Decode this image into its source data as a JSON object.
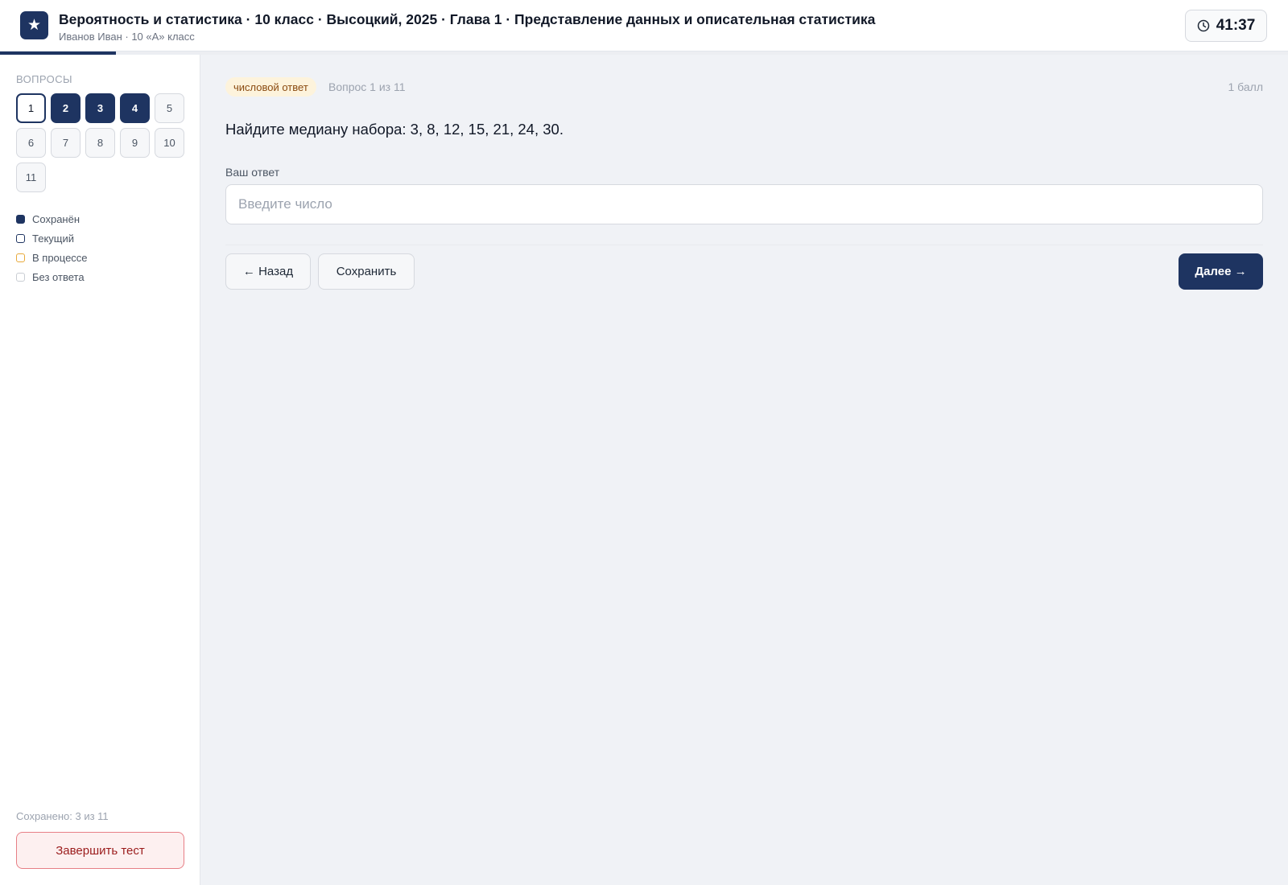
{
  "header": {
    "title": "Вероятность и статистика · 10 класс · Высоцкий, 2025 · Глава 1 · Представление данных и описательная статистика",
    "subtitle": "Иванов Иван · 10 «А» класс",
    "logo_glyph": "★",
    "timer": "41:37",
    "progress_fraction": 0.09
  },
  "sidebar": {
    "heading": "ВОПРОСЫ",
    "questions": [
      {
        "label": "1",
        "status": "current"
      },
      {
        "label": "2",
        "status": "saved"
      },
      {
        "label": "3",
        "status": "saved"
      },
      {
        "label": "4",
        "status": "saved"
      },
      {
        "label": "5",
        "status": "empty"
      },
      {
        "label": "6",
        "status": "empty"
      },
      {
        "label": "7",
        "status": "empty"
      },
      {
        "label": "8",
        "status": "empty"
      },
      {
        "label": "9",
        "status": "empty"
      },
      {
        "label": "10",
        "status": "empty"
      },
      {
        "label": "11",
        "status": "empty"
      }
    ],
    "legend": [
      {
        "key": "saved",
        "label": "Сохранён"
      },
      {
        "key": "current",
        "label": "Текущий"
      },
      {
        "key": "progress",
        "label": "В процессе"
      },
      {
        "key": "empty",
        "label": "Без ответа"
      }
    ],
    "saved_count": "Сохранено: 3 из 11",
    "finish_label": "Завершить тест"
  },
  "question": {
    "type_tag": "числовой ответ",
    "counter": "Вопрос 1 из 11",
    "points": "1 балл",
    "text": "Найдите медиану набора: 3, 8, 12, 15, 21, 24, 30.",
    "answer_label": "Ваш ответ",
    "answer_placeholder": "Введите число",
    "answer_value": ""
  },
  "nav": {
    "back_label": "← Назад",
    "save_label": "Сохранить",
    "next_label": "Далее →"
  },
  "colors": {
    "accent": "#1e3461",
    "in_progress": "#e8a93a",
    "danger": "#e77f86"
  }
}
